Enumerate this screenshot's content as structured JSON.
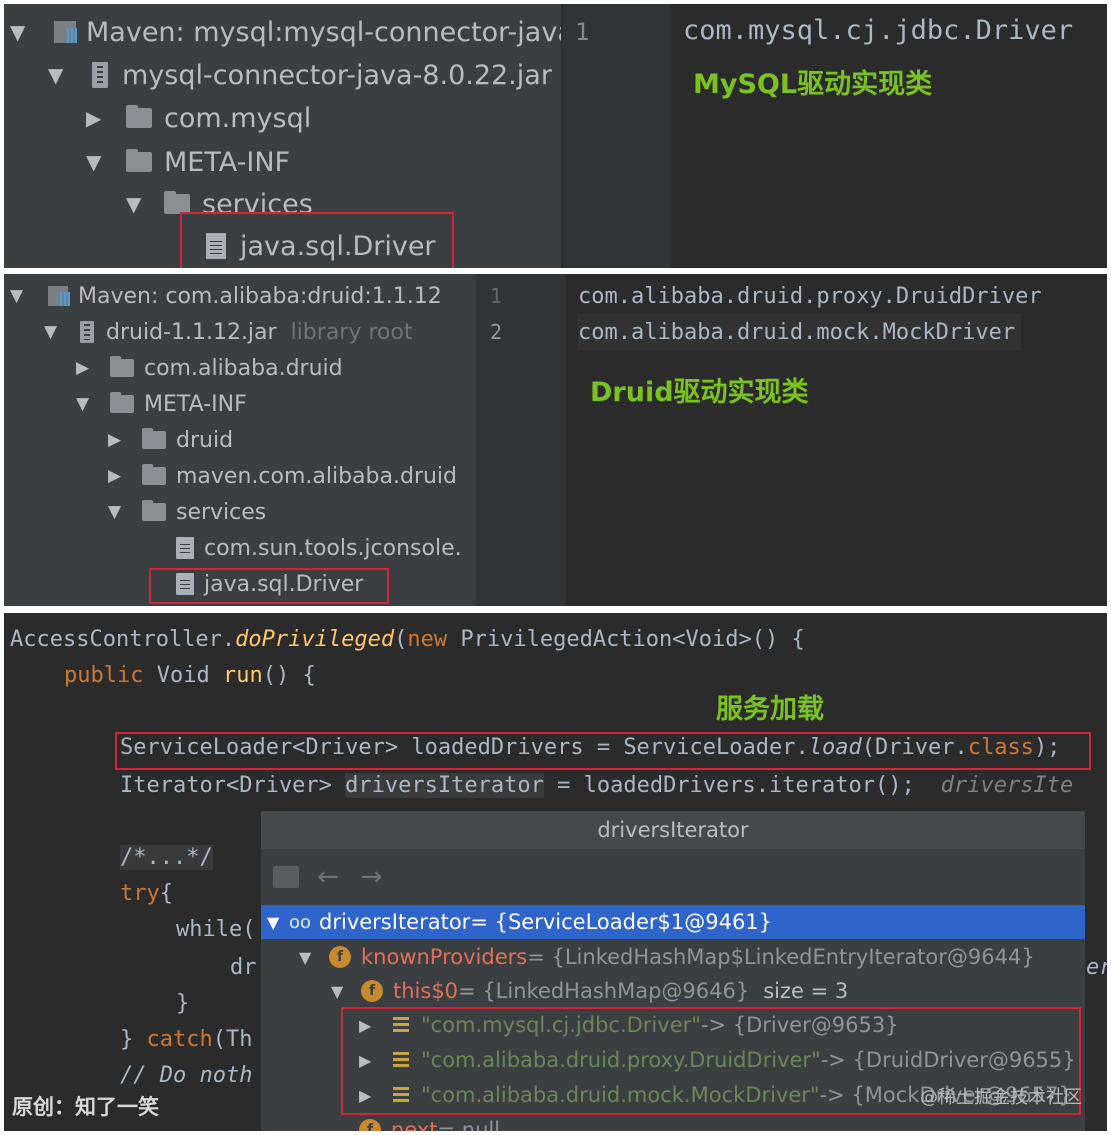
{
  "panel_mysql": {
    "tree": [
      {
        "arrow": "▼",
        "icon": "maven-library-icon",
        "label": "Maven: mysql:mysql-connector-java:"
      },
      {
        "arrow": "▼",
        "icon": "jar-icon",
        "label": "mysql-connector-java-8.0.22.jar"
      },
      {
        "arrow": "▶",
        "icon": "folder-icon",
        "label": "com.mysql"
      },
      {
        "arrow": "▼",
        "icon": "folder-icon",
        "label": "META-INF"
      },
      {
        "arrow": "▼",
        "icon": "folder-icon",
        "label": "services"
      },
      {
        "arrow": "",
        "icon": "file-icon",
        "label": "java.sql.Driver"
      }
    ],
    "line_numbers": [
      "1"
    ],
    "code_lines": [
      "com.mysql.cj.jdbc.Driver"
    ],
    "caption": "MySQL驱动实现类"
  },
  "panel_druid": {
    "tree": [
      {
        "arrow": "▼",
        "icon": "maven-library-icon",
        "label": "Maven: com.alibaba:druid:1.1.12",
        "suffix": ""
      },
      {
        "arrow": "▼",
        "icon": "jar-icon",
        "label": "druid-1.1.12.jar",
        "suffix": "library root"
      },
      {
        "arrow": "▶",
        "icon": "folder-icon",
        "label": "com.alibaba.druid",
        "suffix": ""
      },
      {
        "arrow": "▼",
        "icon": "folder-icon",
        "label": "META-INF",
        "suffix": ""
      },
      {
        "arrow": "▶",
        "icon": "folder-icon",
        "label": "druid",
        "suffix": ""
      },
      {
        "arrow": "▶",
        "icon": "folder-icon",
        "label": "maven.com.alibaba.druid",
        "suffix": ""
      },
      {
        "arrow": "▼",
        "icon": "folder-icon",
        "label": "services",
        "suffix": ""
      },
      {
        "arrow": "",
        "icon": "file-icon",
        "label": "com.sun.tools.jconsole.",
        "suffix": ""
      },
      {
        "arrow": "",
        "icon": "file-icon",
        "label": "java.sql.Driver",
        "suffix": ""
      }
    ],
    "line_numbers": [
      "1",
      "2"
    ],
    "code_lines": [
      "com.alibaba.druid.proxy.DruidDriver",
      "com.alibaba.druid.mock.MockDriver"
    ],
    "caption": "Druid驱动实现类"
  },
  "code_panel": {
    "line1": {
      "a": "AccessController.",
      "b": "doPrivileged",
      "c": "(",
      "d": "new",
      "e": " PrivilegedAction<Void>() {"
    },
    "line2": {
      "a": "public",
      "b": " Void ",
      "c": "run",
      "d": "() {"
    },
    "caption": "服务加载",
    "line3": {
      "a": "ServiceLoader<Driver> loadedDrivers = ServiceLoader.",
      "b": "load",
      "c": "(Driver.",
      "d": "class",
      "e": ");"
    },
    "line4": {
      "a": "Iterator<Driver> ",
      "b": "driversIterator",
      "c": " = loadedDrivers.iterator();",
      "d": "driversIte"
    },
    "line5": "/*...*/",
    "line6": {
      "a": "try",
      "b": "{"
    },
    "line7": "while(",
    "line8": "dr",
    "line9": "}",
    "line10": {
      "a": "} ",
      "b": "catch",
      "c": "(Th"
    },
    "line11": "// Do noth",
    "right_fragment": "er"
  },
  "popup": {
    "title": "driversIterator",
    "back_label": "←",
    "forward_label": "→",
    "root": {
      "name": "driversIterator",
      "value": " = {ServiceLoader$1@9461}"
    },
    "known": {
      "name": "knownProviders",
      "value": " = {LinkedHashMap$LinkedEntryIterator@9644}"
    },
    "this0": {
      "name": "this$0",
      "value": " = {LinkedHashMap@9646}",
      "size": "size = 3"
    },
    "entries": [
      {
        "key": "\"com.mysql.cj.jdbc.Driver\"",
        "value": " -> {Driver@9653}"
      },
      {
        "key": "\"com.alibaba.druid.proxy.DruidDriver\"",
        "value": " -> {DruidDriver@9655}"
      },
      {
        "key": "\"com.alibaba.druid.mock.MockDriver\"",
        "value": " -> {MockDriver@9657}"
      }
    ],
    "next": {
      "name": "next",
      "value": " = null"
    }
  },
  "watermark_left": "原创：知了一笑",
  "watermark_right": "@稀土掘金技术社区",
  "colors": {
    "accent_green": "#7ac21f",
    "highlight_red": "#d0263a",
    "selection_blue": "#2f65ca"
  }
}
